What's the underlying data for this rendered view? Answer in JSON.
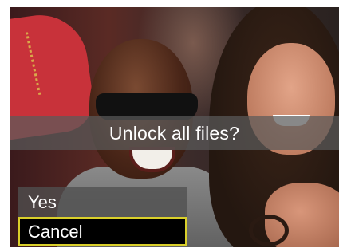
{
  "dialog": {
    "prompt": "Unlock all files?",
    "options": [
      {
        "label": "Yes",
        "selected": false
      },
      {
        "label": "Cancel",
        "selected": true
      }
    ]
  },
  "colors": {
    "selection_border": "#d9cf2a",
    "banner_bg": "#5a5a5a",
    "selected_bg": "#000000"
  }
}
